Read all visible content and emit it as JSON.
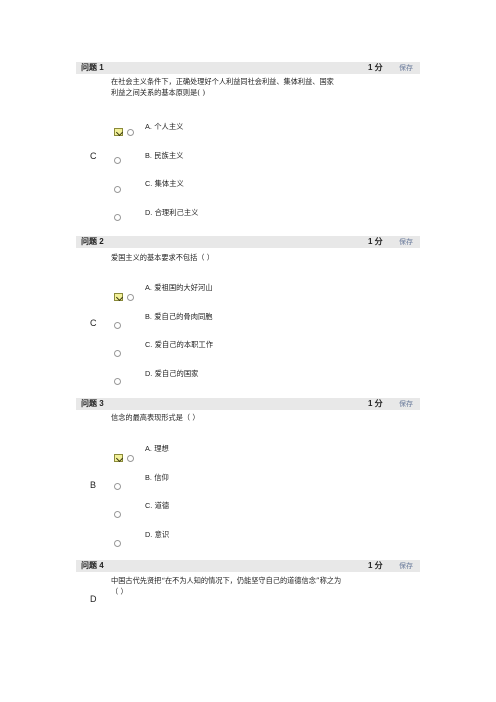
{
  "questions": [
    {
      "title": "问题 1",
      "points": "1 分",
      "save": "保存",
      "text_lines": [
        "在社会主义条件下，正确处理好个人利益同社会利益、集体利益、国家",
        "利益之间关系的基本原则是(      )"
      ],
      "answer": "C",
      "options": [
        {
          "letter": "A.",
          "text": "个人主义"
        },
        {
          "letter": "B.",
          "text": "民族主义"
        },
        {
          "letter": "C.",
          "text": "集体主义"
        },
        {
          "letter": "D.",
          "text": "合理利己主义"
        }
      ]
    },
    {
      "title": "问题 2",
      "points": "1 分",
      "save": "保存",
      "text_lines": [
        "爱国主义的基本要求不包括（     ）"
      ],
      "answer": "C",
      "options": [
        {
          "letter": "A.",
          "text": "爱祖国的大好河山"
        },
        {
          "letter": "B.",
          "text": "爱自己的骨肉同胞"
        },
        {
          "letter": "C.",
          "text": "爱自己的本职工作"
        },
        {
          "letter": "D.",
          "text": "爱自己的国家"
        }
      ]
    },
    {
      "title": "问题 3",
      "points": "1 分",
      "save": "保存",
      "text_lines": [
        "信念的最高表现形式是（     ）"
      ],
      "answer": "B",
      "options": [
        {
          "letter": "A.",
          "text": "理想"
        },
        {
          "letter": "B.",
          "text": "信仰"
        },
        {
          "letter": "C.",
          "text": "道德"
        },
        {
          "letter": "D.",
          "text": "意识"
        }
      ]
    },
    {
      "title": "问题 4",
      "points": "1 分",
      "save": "保存",
      "text_lines": [
        "中国古代先贤把“在不为人知的情况下，仍能坚守自己的道德信念”称之为",
        "（     ）"
      ],
      "answer": "D",
      "options": []
    }
  ]
}
